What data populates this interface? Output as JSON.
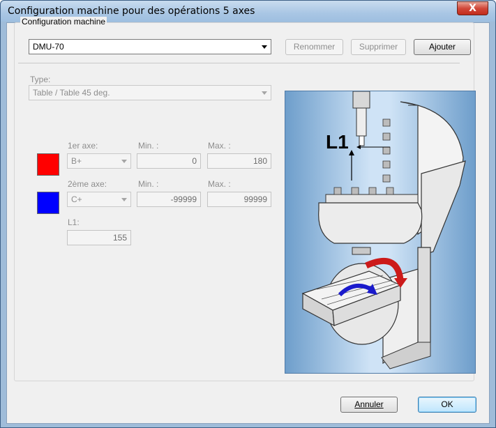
{
  "window": {
    "title": "Configuration machine pour des opérations 5 axes",
    "close_label": "X"
  },
  "group": {
    "label": "Configuration machine",
    "machine_value": "DMU-70",
    "buttons": {
      "rename": "Renommer",
      "delete": "Supprimer",
      "add": "Ajouter"
    }
  },
  "type": {
    "label": "Type:",
    "value": "Table / Table 45 deg."
  },
  "axis1": {
    "label": "1er axe:",
    "value": "B+",
    "min_label": "Min. :",
    "min_value": "0",
    "max_label": "Max. :",
    "max_value": "180",
    "color": "#ff0000"
  },
  "axis2": {
    "label": "2ème axe:",
    "value": "C+",
    "min_label": "Min. :",
    "min_value": "-99999",
    "max_label": "Max. :",
    "max_value": "99999",
    "color": "#0000ff"
  },
  "l1": {
    "label": "L1:",
    "value": "155"
  },
  "illustration": {
    "label": "L1"
  },
  "footer": {
    "cancel": "Annuler",
    "ok": "OK"
  }
}
